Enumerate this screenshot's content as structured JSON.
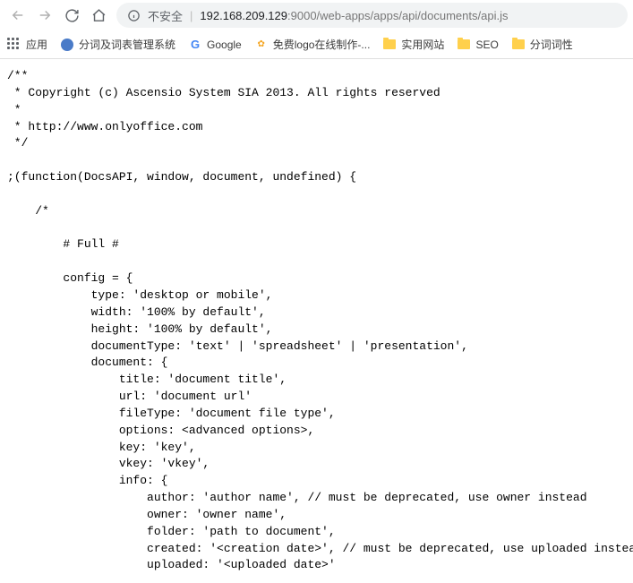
{
  "addr": {
    "insecure": "不安全",
    "host": "192.168.209.129",
    "port_path": ":9000/web-apps/apps/api/documents/api.js"
  },
  "bookmarks": {
    "apps": "应用",
    "items": [
      {
        "label": "分词及词表管理系统"
      },
      {
        "label": "Google"
      },
      {
        "label": "免费logo在线制作-..."
      },
      {
        "label": "实用网站"
      },
      {
        "label": "SEO"
      },
      {
        "label": "分词词性"
      }
    ]
  },
  "code_lines": [
    "/**",
    " * Copyright (c) Ascensio System SIA 2013. All rights reserved",
    " *",
    " * http://www.onlyoffice.com",
    " */",
    "",
    ";(function(DocsAPI, window, document, undefined) {",
    "",
    "    /*",
    "",
    "        # Full #",
    "",
    "        config = {",
    "            type: 'desktop or mobile',",
    "            width: '100% by default',",
    "            height: '100% by default',",
    "            documentType: 'text' | 'spreadsheet' | 'presentation',",
    "            document: {",
    "                title: 'document title',",
    "                url: 'document url'",
    "                fileType: 'document file type',",
    "                options: <advanced options>,",
    "                key: 'key',",
    "                vkey: 'vkey',",
    "                info: {",
    "                    author: 'author name', // must be deprecated, use owner instead",
    "                    owner: 'owner name',",
    "                    folder: 'path to document',",
    "                    created: '<creation date>', // must be deprecated, use uploaded instead",
    "                    uploaded: '<uploaded date>'"
  ]
}
